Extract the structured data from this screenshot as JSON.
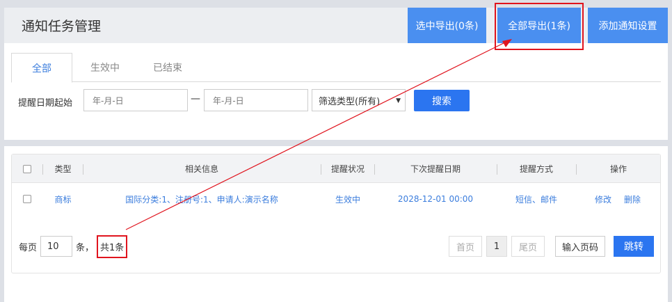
{
  "header": {
    "title": "通知任务管理",
    "export_selected_label": "选中导出(0条)",
    "export_all_label": "全部导出(1条)",
    "add_setting_label": "添加通知设置"
  },
  "tabs": [
    {
      "label": "全部",
      "active": true
    },
    {
      "label": "生效中",
      "active": false
    },
    {
      "label": "已结束",
      "active": false
    }
  ],
  "filter": {
    "date_label": "提醒日期起始",
    "start_placeholder": "年-月-日",
    "separator": "—",
    "end_placeholder": "年-月-日",
    "type_select_value": "筛选类型(所有)",
    "search_label": "搜索"
  },
  "table": {
    "columns": [
      "类型",
      "相关信息",
      "提醒状况",
      "下次提醒日期",
      "提醒方式",
      "操作"
    ],
    "rows": [
      {
        "type": "商标",
        "info": "国际分类:1、注册号:1、申请人:演示名称",
        "status": "生效中",
        "next_date": "2028-12-01 00:00",
        "method": "短信、邮件",
        "edit_label": "修改",
        "delete_label": "删除"
      }
    ]
  },
  "pagination": {
    "per_page_label": "每页",
    "per_page_value": "10",
    "unit_label": "条，",
    "total_label": "共1条",
    "first_label": "首页",
    "current_page": "1",
    "last_label": "尾页",
    "goto_placeholder": "输入页码",
    "jump_label": "跳转"
  },
  "colors": {
    "primary": "#2b75f0",
    "header_button": "#4a8ff0",
    "highlight": "#e0141e",
    "link": "#3b7ddd"
  }
}
